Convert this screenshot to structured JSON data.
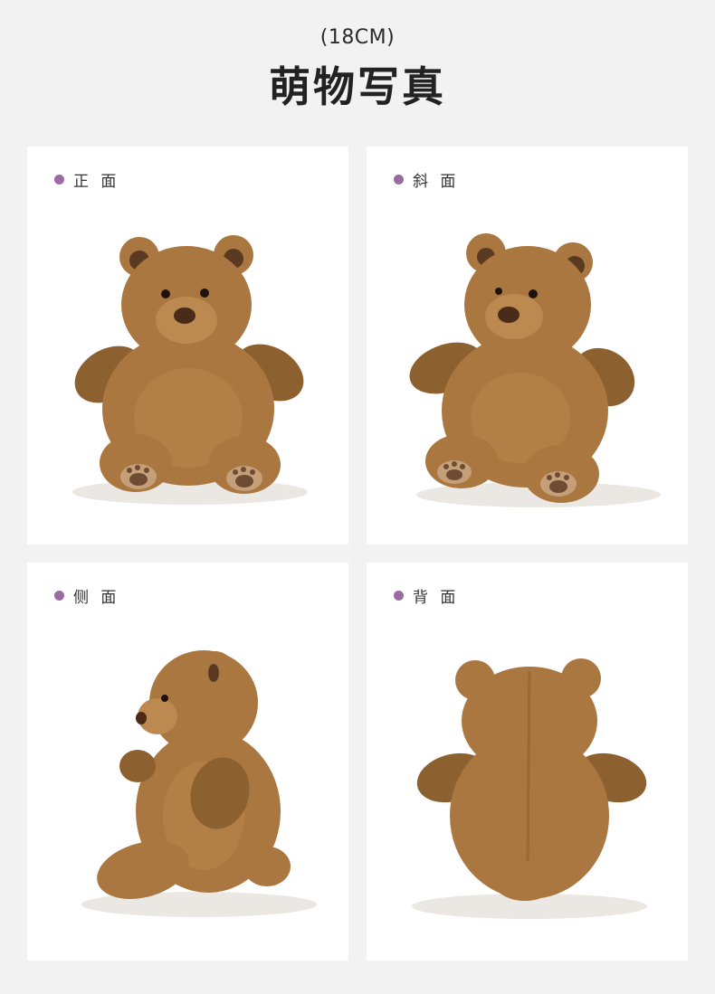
{
  "header": {
    "subtitle": "(18CM)",
    "title": "萌物写真"
  },
  "cards": [
    {
      "label": "正 面",
      "view": "front"
    },
    {
      "label": "斜 面",
      "view": "angled"
    },
    {
      "label": "侧 面",
      "view": "side"
    },
    {
      "label": "背 面",
      "view": "back"
    }
  ],
  "colors": {
    "background": "#f2f2f2",
    "card": "#ffffff",
    "accent_dot": "#9c6aa3",
    "fur": "#a9773f"
  }
}
